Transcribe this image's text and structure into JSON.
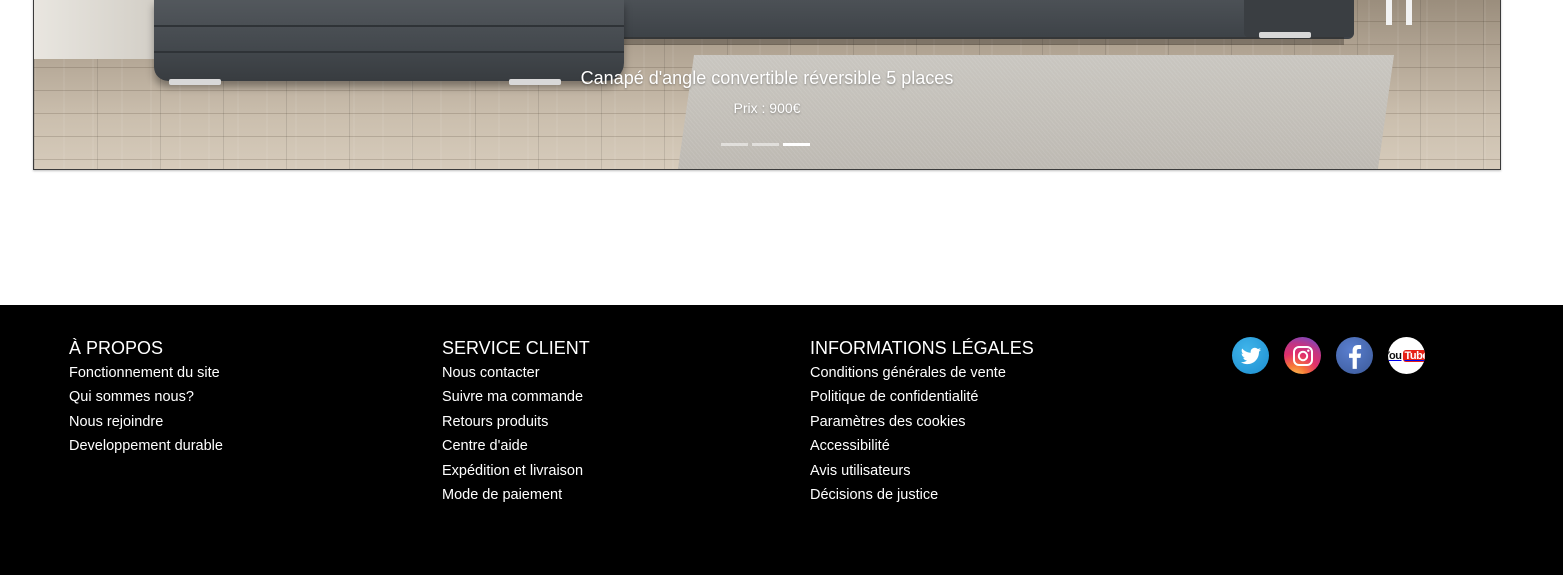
{
  "carousel": {
    "title": "Canapé d'angle convertible réversible 5 places",
    "price": "Prix : 900€",
    "indicators": [
      {
        "active": false
      },
      {
        "active": false
      },
      {
        "active": true
      }
    ]
  },
  "footer": {
    "about": {
      "heading": "À PROPOS",
      "links": [
        "Fonctionnement du site",
        "Qui sommes nous?",
        "Nous rejoindre",
        "Developpement durable"
      ]
    },
    "service": {
      "heading": "SERVICE CLIENT",
      "links": [
        "Nous contacter",
        "Suivre ma commande",
        "Retours produits",
        "Centre d'aide",
        "Expédition et livraison",
        "Mode de paiement"
      ]
    },
    "legal": {
      "heading": "INFORMATIONS LÉGALES",
      "links": [
        "Conditions générales de vente",
        "Politique de confidentialité",
        "Paramètres des cookies",
        "Accessibilité",
        "Avis utilisateurs",
        "Décisions de justice"
      ]
    },
    "social": [
      {
        "name": "twitter-icon",
        "color": "#1d8fd1"
      },
      {
        "name": "instagram-icon",
        "color": "#e1306c"
      },
      {
        "name": "facebook-icon",
        "color": "#3b5998"
      },
      {
        "name": "youtube-icon",
        "color": "#e62117",
        "you": "You",
        "tube": "Tube"
      }
    ]
  }
}
